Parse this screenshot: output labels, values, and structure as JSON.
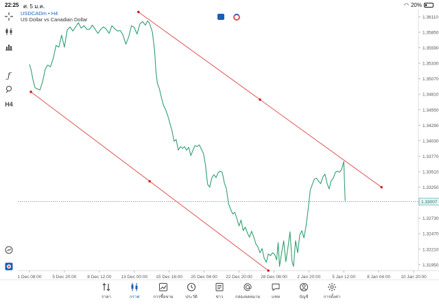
{
  "status_bar": {
    "time": "22:25",
    "date": "ศ. 5 ม.ค.",
    "battery": "20%",
    "battery_level": 0.2
  },
  "toolbar": {
    "tools": [
      {
        "name": "crosshair-icon"
      },
      {
        "name": "candlestick-type-icon"
      },
      {
        "name": "indicators-icon"
      },
      {
        "name": "function-icon"
      },
      {
        "name": "objects-icon"
      },
      {
        "name": "timeframe-label",
        "label": "H4"
      }
    ]
  },
  "chart": {
    "symbol": "USDCADm",
    "timeframe": "H4",
    "symbol_line": "USDCADm • H4",
    "description": "US Dollar vs Canadian Dollar",
    "current_price_label": "1.33007",
    "colors": {
      "price_line": "#2e9e6e",
      "channel": "#e05050",
      "current_price": "#3aa0a0",
      "accent": "#1a5fb4"
    }
  },
  "chart_data": {
    "type": "line",
    "title": "USDCADm • H4",
    "subtitle": "US Dollar vs Canadian Dollar",
    "x_ticks": [
      "1 Dec 08:00",
      "5 Dec 20:00",
      "8 Dec 12:00",
      "13 Dec 00:00",
      "15 Dec 16:00",
      "20 Dec 04:00",
      "22 Dec 20:00",
      "28 Dec 08:00",
      "2 Jan 20:00",
      "5 Jan 12:00",
      "8 Jan 04:00",
      "10 Jan 20:00"
    ],
    "y_ticks": [
      1.3611,
      1.3585,
      1.3559,
      1.3533,
      1.3507,
      1.3481,
      1.3455,
      1.3429,
      1.3403,
      1.3377,
      1.3351,
      1.3325,
      1.3299,
      1.3273,
      1.3247,
      1.3221,
      1.3195
    ],
    "y_tick_labels": [
      "1.36110",
      "1.35850",
      "1.35590",
      "1.35330",
      "1.35070",
      "1.34810",
      "1.34550",
      "1.34290",
      "1.34030",
      "1.33770",
      "1.33510",
      "1.33250",
      "1.32990",
      "1.32730",
      "1.32470",
      "1.32210",
      "1.31950"
    ],
    "ylim": [
      1.3185,
      1.3623
    ],
    "x_range": [
      0,
      11
    ],
    "series": [
      {
        "values": [
          [
            0.0,
            1.3531
          ],
          [
            0.05,
            1.3521
          ],
          [
            0.1,
            1.3505
          ],
          [
            0.16,
            1.3492
          ],
          [
            0.22,
            1.349
          ],
          [
            0.3,
            1.3488
          ],
          [
            0.38,
            1.3503
          ],
          [
            0.45,
            1.3523
          ],
          [
            0.52,
            1.353
          ],
          [
            0.6,
            1.3527
          ],
          [
            0.68,
            1.3541
          ],
          [
            0.76,
            1.3563
          ],
          [
            0.84,
            1.356
          ],
          [
            0.92,
            1.358
          ],
          [
            1.0,
            1.356
          ],
          [
            1.08,
            1.3589
          ],
          [
            1.16,
            1.3594
          ],
          [
            1.24,
            1.3587
          ],
          [
            1.32,
            1.3594
          ],
          [
            1.4,
            1.3601
          ],
          [
            1.48,
            1.3592
          ],
          [
            1.56,
            1.3596
          ],
          [
            1.64,
            1.359
          ],
          [
            1.72,
            1.359
          ],
          [
            1.8,
            1.3597
          ],
          [
            1.88,
            1.359
          ],
          [
            1.96,
            1.3583
          ],
          [
            2.04,
            1.359
          ],
          [
            2.12,
            1.3594
          ],
          [
            2.2,
            1.359
          ],
          [
            2.28,
            1.3583
          ],
          [
            2.36,
            1.3596
          ],
          [
            2.44,
            1.3591
          ],
          [
            2.52,
            1.3587
          ],
          [
            2.6,
            1.3588
          ],
          [
            2.68,
            1.358
          ],
          [
            2.76,
            1.3565
          ],
          [
            2.84,
            1.3577
          ],
          [
            2.92,
            1.3596
          ],
          [
            3.0,
            1.3593
          ],
          [
            3.08,
            1.3582
          ],
          [
            3.16,
            1.3599
          ],
          [
            3.24,
            1.3603
          ],
          [
            3.32,
            1.3597
          ],
          [
            3.38,
            1.3604
          ],
          [
            3.44,
            1.36
          ],
          [
            3.52,
            1.3585
          ],
          [
            3.58,
            1.3555
          ],
          [
            3.62,
            1.352
          ],
          [
            3.66,
            1.35
          ],
          [
            3.72,
            1.349
          ],
          [
            3.78,
            1.3475
          ],
          [
            3.84,
            1.3462
          ],
          [
            3.9,
            1.3455
          ],
          [
            3.96,
            1.3445
          ],
          [
            4.02,
            1.3432
          ],
          [
            4.08,
            1.342
          ],
          [
            4.14,
            1.3402
          ],
          [
            4.2,
            1.3405
          ],
          [
            4.26,
            1.3387
          ],
          [
            4.32,
            1.3393
          ],
          [
            4.38,
            1.339
          ],
          [
            4.44,
            1.3393
          ],
          [
            4.5,
            1.3387
          ],
          [
            4.56,
            1.3392
          ],
          [
            4.62,
            1.3378
          ],
          [
            4.68,
            1.3387
          ],
          [
            4.74,
            1.3395
          ],
          [
            4.8,
            1.3393
          ],
          [
            4.86,
            1.3396
          ],
          [
            4.92,
            1.3389
          ],
          [
            4.98,
            1.3382
          ],
          [
            5.04,
            1.3362
          ],
          [
            5.1,
            1.333
          ],
          [
            5.16,
            1.3325
          ],
          [
            5.22,
            1.334
          ],
          [
            5.28,
            1.3346
          ],
          [
            5.34,
            1.3341
          ],
          [
            5.4,
            1.3349
          ],
          [
            5.46,
            1.3352
          ],
          [
            5.52,
            1.335
          ],
          [
            5.58,
            1.3332
          ],
          [
            5.64,
            1.3322
          ],
          [
            5.7,
            1.3297
          ],
          [
            5.76,
            1.3288
          ],
          [
            5.82,
            1.328
          ],
          [
            5.88,
            1.3283
          ],
          [
            5.94,
            1.3272
          ],
          [
            6.0,
            1.326
          ],
          [
            6.06,
            1.327
          ],
          [
            6.12,
            1.3252
          ],
          [
            6.18,
            1.3258
          ],
          [
            6.24,
            1.3248
          ],
          [
            6.3,
            1.3241
          ],
          [
            6.36,
            1.3251
          ],
          [
            6.42,
            1.3242
          ],
          [
            6.48,
            1.323
          ],
          [
            6.54,
            1.3225
          ],
          [
            6.6,
            1.3215
          ],
          [
            6.66,
            1.3222
          ],
          [
            6.72,
            1.3206
          ],
          [
            6.78,
            1.3199
          ],
          [
            6.84,
            1.3213
          ],
          [
            6.9,
            1.321
          ],
          [
            6.96,
            1.3215
          ],
          [
            7.02,
            1.3212
          ],
          [
            7.08,
            1.3203
          ],
          [
            7.12,
            1.3232
          ],
          [
            7.16,
            1.3192
          ],
          [
            7.22,
            1.3215
          ],
          [
            7.28,
            1.3235
          ],
          [
            7.34,
            1.32
          ],
          [
            7.4,
            1.3223
          ],
          [
            7.46,
            1.325
          ],
          [
            7.52,
            1.32
          ],
          [
            7.56,
            1.3192
          ],
          [
            7.62,
            1.3235
          ],
          [
            7.68,
            1.3215
          ],
          [
            7.74,
            1.3245
          ],
          [
            7.8,
            1.3252
          ],
          [
            7.86,
            1.324
          ],
          [
            7.92,
            1.326
          ],
          [
            7.98,
            1.3288
          ],
          [
            8.04,
            1.332
          ],
          [
            8.1,
            1.333
          ],
          [
            8.16,
            1.3339
          ],
          [
            8.22,
            1.334
          ],
          [
            8.28,
            1.3335
          ],
          [
            8.34,
            1.3331
          ],
          [
            8.4,
            1.3342
          ],
          [
            8.46,
            1.3347
          ],
          [
            8.52,
            1.3332
          ],
          [
            8.58,
            1.3322
          ],
          [
            8.64,
            1.3336
          ],
          [
            8.7,
            1.334
          ],
          [
            8.76,
            1.335
          ],
          [
            8.82,
            1.3352
          ],
          [
            8.88,
            1.335
          ],
          [
            8.94,
            1.3355
          ],
          [
            9.0,
            1.3368
          ],
          [
            9.04,
            1.3302
          ]
        ]
      }
    ],
    "channel_lines": [
      {
        "from": [
          3.12,
          1.3619
        ],
        "to": [
          10.08,
          1.3325
        ],
        "midpoint": [
          6.6,
          1.3472
        ]
      },
      {
        "from": [
          0.04,
          1.3485
        ],
        "to": [
          6.84,
          1.3185
        ],
        "midpoint": [
          3.44,
          1.3335
        ]
      }
    ],
    "current_price": 1.33007,
    "grid": true
  },
  "bottom_nav": {
    "items": [
      {
        "label": "ราคา",
        "icon": "quotes-icon"
      },
      {
        "label": "กราฟ",
        "icon": "chart-icon",
        "active": true
      },
      {
        "label": "การซื้อขาย",
        "icon": "trade-icon"
      },
      {
        "label": "ประวัติ",
        "icon": "history-icon"
      },
      {
        "label": "ข่าว",
        "icon": "news-icon"
      },
      {
        "label": "กล่องจดหมาย",
        "icon": "mailbox-icon"
      },
      {
        "label": "แชท",
        "icon": "chat-icon"
      },
      {
        "label": "บัญชี",
        "icon": "account-icon"
      },
      {
        "label": "การตั้งค่า",
        "icon": "settings-icon"
      }
    ]
  }
}
